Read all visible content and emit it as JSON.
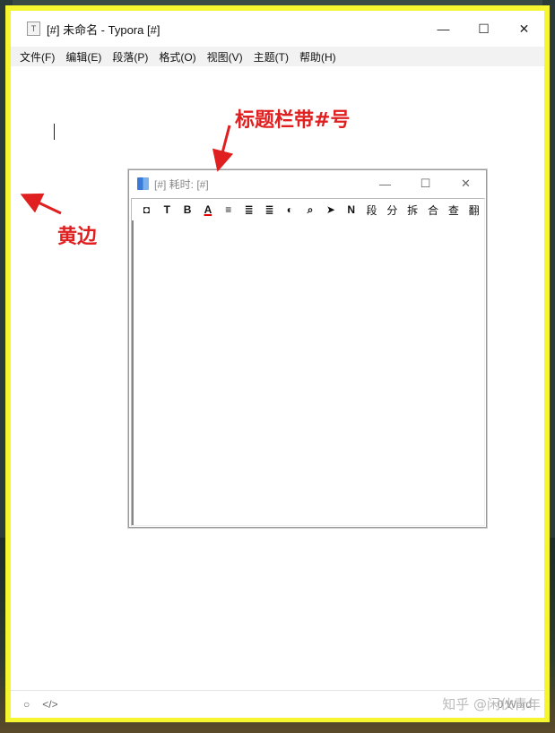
{
  "main": {
    "title": "[#] 未命名 - Typora [#]",
    "app_icon": "T",
    "window_buttons": {
      "minimize": "—",
      "maximize": "☐",
      "close": "✕"
    },
    "menu": [
      "文件(F)",
      "编辑(E)",
      "段落(P)",
      "格式(O)",
      "视图(V)",
      "主题(T)",
      "帮助(H)"
    ],
    "status": {
      "circle_icon": "○",
      "code_icon": "</>",
      "word_count": "0 Word"
    }
  },
  "annotations": {
    "title_note": "标题栏带#号",
    "edge_note": "黄边",
    "color": "#e02020"
  },
  "dialog": {
    "title": "[#] 耗时: [#]",
    "window_buttons": {
      "minimize": "—",
      "maximize": "☐",
      "close": "✕"
    },
    "toolbar": [
      "◘",
      "T",
      "B",
      "A",
      "≡",
      "≣",
      "≣",
      "◐",
      "⌕",
      "➤",
      "N",
      "段",
      "分",
      "拆",
      "合",
      "查",
      "翻"
    ]
  },
  "watermark": "知乎 @闲伙青年",
  "colors": {
    "window_border": "#f5f530",
    "accent": "#e02020"
  }
}
